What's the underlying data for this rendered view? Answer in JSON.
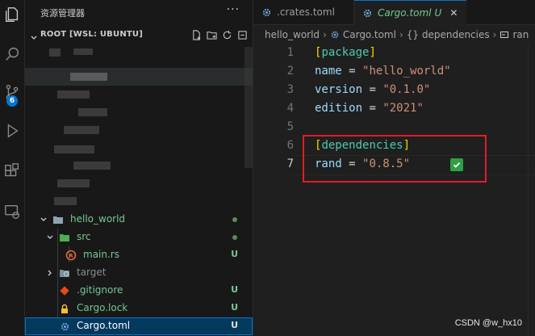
{
  "activity_bar": {
    "icons": [
      "explorer-icon",
      "search-icon",
      "source-control-icon",
      "run-debug-icon",
      "extensions-icon",
      "remote-explorer-icon"
    ],
    "scm_badge": "6"
  },
  "explorer": {
    "title": "资源管理器",
    "more_label": "···",
    "root_label": "ROOT [WSL: UBUNTU]",
    "tree": [
      {
        "label": "hello_world",
        "status": "",
        "dot": true
      },
      {
        "label": "src",
        "status": "",
        "dot": true
      },
      {
        "label": "main.rs",
        "status": "U"
      },
      {
        "label": "target",
        "status": ""
      },
      {
        "label": ".gitignore",
        "status": "U"
      },
      {
        "label": "Cargo.lock",
        "status": "U"
      },
      {
        "label": "Cargo.toml",
        "status": "U"
      }
    ]
  },
  "editor": {
    "tabs": [
      {
        "label": ".crates.toml"
      },
      {
        "label": "Cargo.toml",
        "status": "U",
        "close": "✕"
      }
    ],
    "breadcrumbs": [
      "hello_world",
      "Cargo.toml",
      "{} dependencies",
      "ran"
    ],
    "lines": [
      {
        "num": "1",
        "tokens": [
          [
            "bracket",
            "["
          ],
          [
            "section",
            "package"
          ],
          [
            "bracket",
            "]"
          ]
        ]
      },
      {
        "num": "2",
        "tokens": [
          [
            "key",
            "name"
          ],
          [
            "op",
            " = "
          ],
          [
            "str",
            "\"hello_world\""
          ]
        ]
      },
      {
        "num": "3",
        "tokens": [
          [
            "key",
            "version"
          ],
          [
            "op",
            " = "
          ],
          [
            "str",
            "\"0.1.0\""
          ]
        ]
      },
      {
        "num": "4",
        "tokens": [
          [
            "key",
            "edition"
          ],
          [
            "op",
            " = "
          ],
          [
            "str",
            "\"2021\""
          ]
        ]
      },
      {
        "num": "5",
        "tokens": []
      },
      {
        "num": "6",
        "tokens": [
          [
            "bracket",
            "["
          ],
          [
            "section",
            "dependencies"
          ],
          [
            "bracket",
            "]"
          ]
        ]
      },
      {
        "num": "7",
        "tokens": [
          [
            "key",
            "rand"
          ],
          [
            "op",
            " = "
          ],
          [
            "str",
            "\"0.8.5\""
          ]
        ]
      }
    ],
    "active_line": "7"
  },
  "colors": {
    "accent": "#0078d4",
    "untracked": "#73c991",
    "highlight_box": "#e51c23",
    "check": "#2ea043"
  },
  "watermark": "CSDN @w_hx10"
}
